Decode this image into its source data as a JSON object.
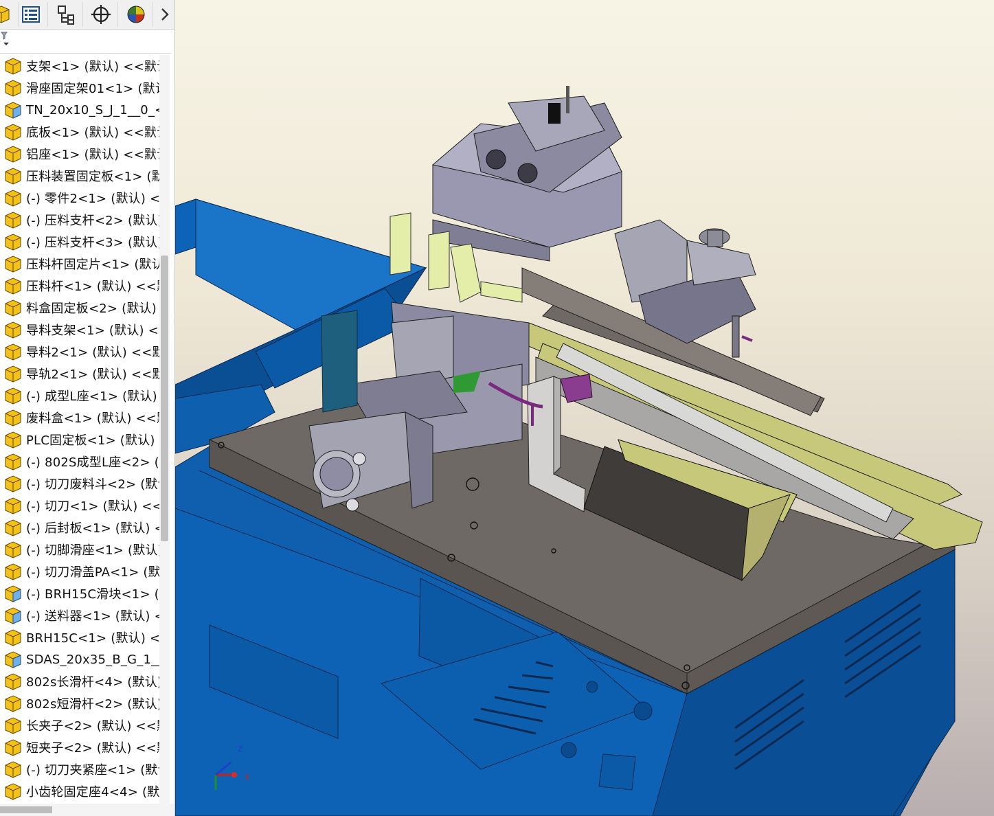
{
  "feature_tree": {
    "items": [
      {
        "label": "支架<1> (默认) <<默认",
        "icon": "part-icon"
      },
      {
        "label": "滑座固定架01<1> (默认",
        "icon": "part-icon"
      },
      {
        "label": "TN_20x10_S_J_1__0_<",
        "icon": "toolbox-part-icon"
      },
      {
        "label": "底板<1> (默认) <<默认",
        "icon": "part-icon"
      },
      {
        "label": "铝座<1> (默认) <<默认",
        "icon": "part-icon"
      },
      {
        "label": "压料装置固定板<1> (默",
        "icon": "part-icon"
      },
      {
        "label": "(-) 零件2<1> (默认) <<",
        "icon": "part-icon"
      },
      {
        "label": "(-) 压料支杆<2> (默认)",
        "icon": "part-icon"
      },
      {
        "label": "(-) 压料支杆<3> (默认)",
        "icon": "part-icon"
      },
      {
        "label": "压料杆固定片<1> (默认",
        "icon": "part-icon"
      },
      {
        "label": "压料杆<1> (默认) <<默",
        "icon": "part-icon"
      },
      {
        "label": "料盒固定板<2> (默认) <",
        "icon": "part-icon"
      },
      {
        "label": "导料支架<1> (默认) <<",
        "icon": "part-icon"
      },
      {
        "label": "导料2<1> (默认) <<默认",
        "icon": "part-icon"
      },
      {
        "label": "导轨2<1> (默认) <<默认",
        "icon": "part-icon"
      },
      {
        "label": "(-) 成型L座<1> (默认) <",
        "icon": "part-icon"
      },
      {
        "label": "废料盒<1> (默认) <<默",
        "icon": "part-icon"
      },
      {
        "label": "PLC固定板<1> (默认) <",
        "icon": "part-icon"
      },
      {
        "label": "(-) 802S成型L座<2> (默",
        "icon": "part-icon"
      },
      {
        "label": "(-) 切刀废料斗<2> (默认",
        "icon": "part-icon"
      },
      {
        "label": "(-) 切刀<1> (默认) <<默",
        "icon": "part-icon"
      },
      {
        "label": "(-) 后封板<1> (默认) <",
        "icon": "part-icon"
      },
      {
        "label": "(-) 切脚滑座<1> (默认)",
        "icon": "part-icon"
      },
      {
        "label": "(-) 切刀滑盖PA<1> (默",
        "icon": "part-icon"
      },
      {
        "label": "(-) BRH15C滑块<1> (默",
        "icon": "toolbox-part-icon"
      },
      {
        "label": "(-) 送料器<1> (默认) <",
        "icon": "toolbox-part-icon"
      },
      {
        "label": "BRH15C<1> (默认) <<",
        "icon": "part-icon"
      },
      {
        "label": "SDAS_20x35_B_G_1__(",
        "icon": "toolbox-part-icon"
      },
      {
        "label": "802s长滑杆<4> (默认)",
        "icon": "part-icon"
      },
      {
        "label": "802s短滑杆<2> (默认)",
        "icon": "part-icon"
      },
      {
        "label": "长夹子<2> (默认) <<默",
        "icon": "part-icon"
      },
      {
        "label": "短夹子<2> (默认) <<默",
        "icon": "part-icon"
      },
      {
        "label": "(-) 切刀夹紧座<1> (默认",
        "icon": "part-icon"
      },
      {
        "label": "小齿轮固定座4<4> (默认",
        "icon": "part-icon"
      }
    ]
  },
  "toolbar": {
    "buttons": [
      "featuremanager-tree-icon",
      "property-manager-icon",
      "configuration-manager-icon",
      "dimxpert-icon",
      "display-manager-icon"
    ],
    "expand_icon": "chevron-right-icon"
  },
  "colors": {
    "part_yellow": "#f2c21a",
    "toolbox_blue": "#4a90d9",
    "frame_blue": "#0a5aa8",
    "plate_gray": "#6e6965",
    "rail_yellow": "#c8c87a"
  },
  "triad": {
    "x_label": "X",
    "z_label": "Z"
  }
}
